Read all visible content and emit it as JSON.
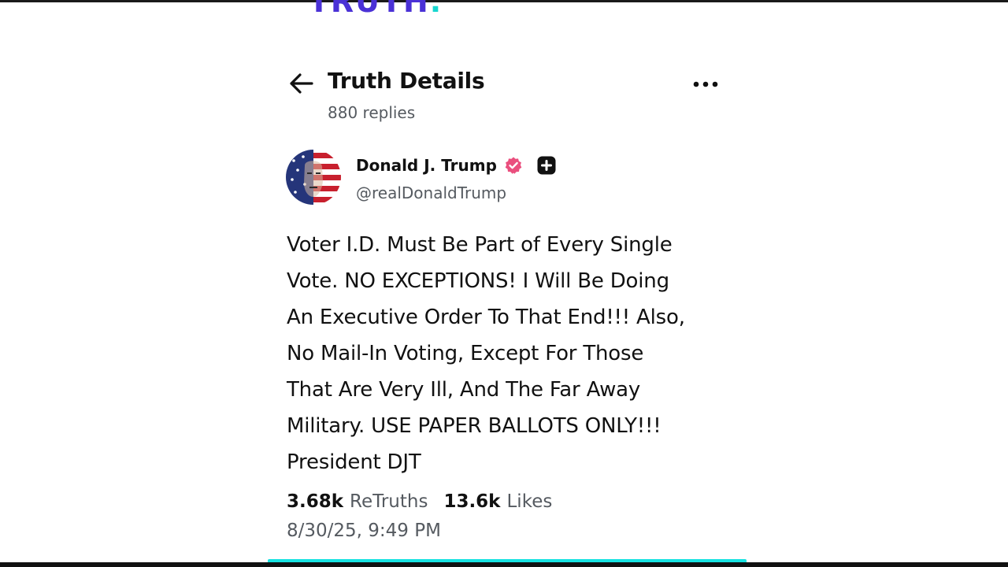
{
  "app": {
    "logo_text": "TRUTH",
    "logo_dot": ".",
    "brand_color": "#4a31d6",
    "accent_color": "#17d6cf"
  },
  "header": {
    "back_icon": "arrow-left-icon",
    "title": "Truth Details",
    "more_icon": "more-horizontal-icon",
    "replies_count": "880 replies"
  },
  "post": {
    "author": {
      "name": "Donald J. Trump",
      "handle": "@realDonaldTrump",
      "verified_icon": "verified-badge-icon",
      "verified_color": "#ea4f7e",
      "plus_icon": "plus-badge-icon"
    },
    "body": "Voter I.D. Must Be Part of Every Single\nVote. NO EXCEPTIONS! I Will Be Doing\nAn Executive Order To That End!!! Also,\nNo Mail-In Voting, Except For Those\nThat Are Very Ill, And The Far Away\nMilitary. USE PAPER BALLOTS ONLY!!!\nPresident DJT",
    "stats": {
      "retruths_count": "3.68k",
      "retruths_label": "ReTruths",
      "likes_count": "13.6k",
      "likes_label": "Likes"
    },
    "timestamp": "8/30/25, 9:49 PM"
  }
}
